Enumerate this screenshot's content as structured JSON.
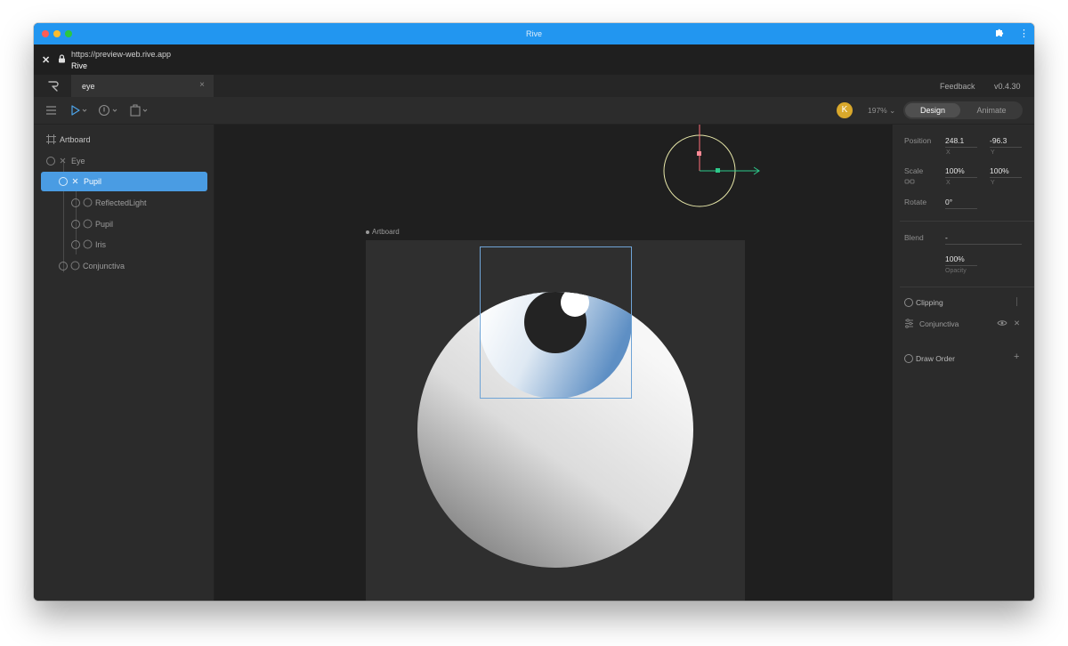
{
  "browser": {
    "window_title": "Rive",
    "url": "https://preview-web.rive.app",
    "page_title": "Rive",
    "extensions_icon": "puzzle-icon",
    "menu_icon": "kebab-menu-icon",
    "close_icon": "close-icon",
    "lock_icon": "lock-icon",
    "close_glyph": "✕",
    "menu_glyph": "⋮"
  },
  "tabs": {
    "active_tab_label": "eye",
    "close_glyph": "×",
    "feedback_label": "Feedback",
    "version": "v0.4.30"
  },
  "toolbar": {
    "user_initial": "K",
    "zoom": "197%",
    "mode_design": "Design",
    "mode_animate": "Animate",
    "active_mode": "Design"
  },
  "hierarchy": {
    "items": [
      {
        "label": "Artboard",
        "level": 0,
        "icon": "artboard-icon",
        "selected": false
      },
      {
        "label": "Eye",
        "level": 1,
        "icon": "group-icon",
        "selected": false
      },
      {
        "label": "Pupil",
        "level": 2,
        "icon": "group-icon",
        "selected": true
      },
      {
        "label": "ReflectedLight",
        "level": 3,
        "icon": "ellipse-icon",
        "selected": false
      },
      {
        "label": "Pupil",
        "level": 3,
        "icon": "ellipse-icon",
        "selected": false
      },
      {
        "label": "Iris",
        "level": 3,
        "icon": "ellipse-icon",
        "selected": false
      },
      {
        "label": "Conjunctiva",
        "level": 1,
        "icon": "ellipse-icon",
        "selected": false
      }
    ]
  },
  "stage": {
    "artboard_label": "Artboard",
    "colors": {
      "stage_bg": "#1f1f1f",
      "artboard_bg": "#2f2f2f",
      "selection": "#6fa4d6",
      "gizmo_circle": "#e6e6a8",
      "gizmo_axis_x": "#2ec98b",
      "gizmo_axis_y": "#ff6f7a"
    }
  },
  "inspector": {
    "position_label": "Position",
    "position_x": "248.1",
    "position_y": "-96.3",
    "x_label": "X",
    "y_label": "Y",
    "scale_label": "Scale",
    "scale_x": "100%",
    "scale_y": "100%",
    "rotate_label": "Rotate",
    "rotate_value": "0°",
    "blend_label": "Blend",
    "blend_value": "-",
    "opacity_value": "100%",
    "opacity_label": "Opacity",
    "clipping_label": "Clipping",
    "clip_shape_label": "Conjunctiva",
    "draw_order_label": "Draw Order",
    "remove_glyph": "✕",
    "add_glyph": "+"
  }
}
